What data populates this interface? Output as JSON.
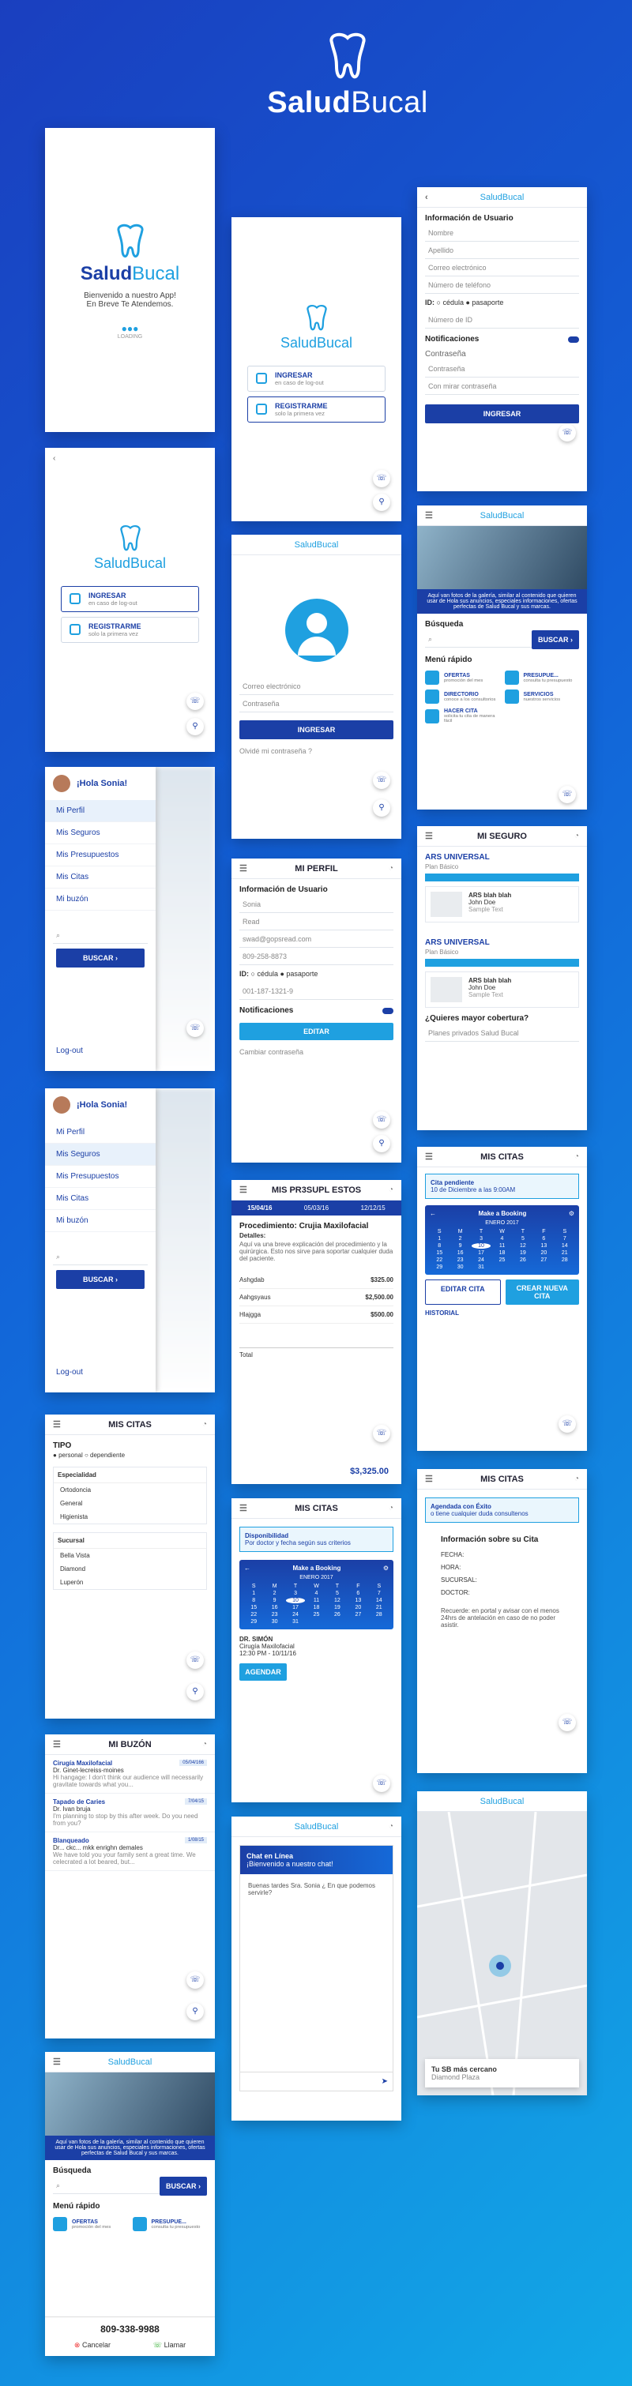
{
  "brand": {
    "name_bold": "Salud",
    "name_light": "Bucal"
  },
  "splash": {
    "welcome": "Bienvenido a nuestro App!",
    "subtitle": "En Breve Te Atendemos.",
    "loading": "LOADING"
  },
  "entry": {
    "login_title": "INGRESAR",
    "login_sub": "en caso de log-out",
    "register_title": "REGISTRARME",
    "register_sub": "solo la primera vez"
  },
  "login": {
    "email_ph": "Correo electrónico",
    "password_ph": "Contraseña",
    "submit": "INGRESAR",
    "forgot": "Olvidé mi contraseña ?"
  },
  "register": {
    "section": "Información de Usuario",
    "fields": [
      "Nombre",
      "Apellido",
      "Correo electrónico",
      "Número de teléfono"
    ],
    "id_label": "ID:",
    "id_opt1": "cédula",
    "id_opt2": "pasaporte",
    "id_number": "Número de ID",
    "notifications": "Notificaciones",
    "password_section": "Contraseña",
    "password": "Contraseña",
    "confirm": "Con mirar contraseña",
    "submit": "INGRESAR"
  },
  "home": {
    "banner": "Aquí van fotos de la galería, similar al contenido que quieren usar de Hola sus anuncios, especiales informaciones, ofertas perfectas de Salud Bucal y sus marcas.",
    "search_label": "Búsqueda",
    "search_button": "BUSCAR ›",
    "quick_label": "Menú rápido",
    "quick": [
      {
        "title": "OFERTAS",
        "sub": "promoción del mes"
      },
      {
        "title": "PRESUPUE...",
        "sub": "consulta tu presupuesto"
      },
      {
        "title": "DIRECTORIO",
        "sub": "conoce a los consultorios"
      },
      {
        "title": "SERVICIOS",
        "sub": "nuestros servicios"
      },
      {
        "title": "HACER CITA",
        "sub": "solicita tu cita de manera fácil"
      }
    ],
    "phone": "809-338-9988",
    "cancel": "Cancelar",
    "call": "Llamar"
  },
  "drawer": {
    "greeting": "¡Hola Sonia!",
    "items": [
      "Mi Perfil",
      "Mis Seguros",
      "Mis Presupuestos",
      "Mis Citas",
      "Mi buzón"
    ],
    "search_button": "BUSCAR ›",
    "logout": "Log-out"
  },
  "profile": {
    "title": "MI PERFIL",
    "section": "Información de Usuario",
    "values": [
      "Sonia",
      "Read",
      "swad@gopsread.com",
      "809-258-8873"
    ],
    "id_label": "ID:",
    "id_opt1": "cédula",
    "id_opt2": "pasaporte",
    "id_value": "001-187-1321-9",
    "notifications": "Notificaciones",
    "edit": "EDITAR",
    "change_password": "Cambiar contraseña"
  },
  "insurance": {
    "title": "MI SEGURO",
    "cards": [
      {
        "name": "ARS UNIVERSAL",
        "plan": "Plan Básico",
        "holder": "ARS blah blah",
        "person": "John Doe",
        "extra": "Sample Text"
      },
      {
        "name": "ARS UNIVERSAL",
        "plan": "Plan Básico",
        "holder": "ARS blah blah",
        "person": "John Doe",
        "extra": "Sample Text"
      }
    ],
    "question": "¿Quieres mayor cobertura?",
    "offer": "Planes privados Salud Bucal"
  },
  "budgets": {
    "title": "MIS PR3SUPL ESTOS",
    "dates": [
      "15/04/16",
      "05/03/16",
      "12/12/15"
    ],
    "procedure": "Procedimiento: Crujia Maxilofacial",
    "details_label": "Detalles:",
    "details": "Aquí va una breve explicación del procedimiento y la quirúrgica. Esto nos sirve para soportar cualquier duda del paciente.",
    "rows": [
      {
        "name": "Ashgdab",
        "value": "$325.00"
      },
      {
        "name": "Aahgsyaus",
        "value": "$2,500.00"
      },
      {
        "name": "Hlajgga",
        "value": "$500.00"
      }
    ],
    "total_label": "Total",
    "total": "$3,325.00"
  },
  "appts": {
    "title": "MIS CITAS",
    "pending": "Cita pendiente",
    "pending_sub": "10 de Diciembre a las 9:00AM",
    "cal_title": "Make a Booking",
    "month": "ENERO 2017",
    "days": [
      "S",
      "M",
      "T",
      "W",
      "T",
      "F",
      "S"
    ],
    "dates": [
      "1",
      "2",
      "3",
      "4",
      "5",
      "6",
      "7",
      "8",
      "9",
      "10",
      "11",
      "12",
      "13",
      "14",
      "15",
      "16",
      "17",
      "18",
      "19",
      "20",
      "21",
      "22",
      "23",
      "24",
      "25",
      "26",
      "27",
      "28",
      "29",
      "30",
      "31"
    ],
    "edit": "EDITAR CITA",
    "new": "CREAR NUEVA CITA",
    "history": "HISTORIAL"
  },
  "filter": {
    "title": "MIS CITAS",
    "type": "TIPO",
    "opt1": "personal",
    "opt2": "dependiente",
    "specialty": "Especialidad",
    "specialties": [
      "Ortodoncia",
      "General",
      "Higienista"
    ],
    "branch": "Sucursal",
    "branches": [
      "Bella Vista",
      "Diamond",
      "Luperón"
    ]
  },
  "avail": {
    "title": "MIS CITAS",
    "note": "Disponibilidad",
    "note_sub": "Por doctor y fecha según sus criterios",
    "doctor": "DR. SIMÓN",
    "specialty": "Cirugía Maxilofacial",
    "time": "12:30 PM - 10/11/16",
    "book": "AGENDAR"
  },
  "success": {
    "title": "MIS CITAS",
    "note": "Agendada con Éxito",
    "note_sub": "o tiene cualquier duda consultenos",
    "info": "Información sobre su Cita",
    "fields": [
      "FECHA:",
      "HORA:",
      "SUCURSAL:",
      "DOCTOR:"
    ],
    "reminder": "Recuerde: en portal y avisar con el menos 24hrs de antelación en caso de no poder asistir."
  },
  "inbox": {
    "title": "MI BUZÓN",
    "mails": [
      {
        "subject": "Cirugía Maxilofacial",
        "from": "Dr. Ginet-lecreiss-moines",
        "body": "Hi hangage: I don't think our audience will necessarily gravitate towards what you...",
        "date": "05/04/166"
      },
      {
        "subject": "Tapado de Caries",
        "from": "Dr. Ivan bruja",
        "body": "I'm planning to stop by this after week. Do you need from you?",
        "date": "7/04/15"
      },
      {
        "subject": "Blanqueado",
        "from": "Dr... ckc... mkk enrighn demales",
        "body": "We have told you your family sent a great time. We celecrated a lot beared, but...",
        "date": "1/08/15"
      }
    ]
  },
  "chat": {
    "header": "Chat en Línea",
    "sub": "¡Bienvenido a nuestro chat!",
    "message": "Buenas tardes Sra. Sonia ¿ En que podemos servirle?"
  },
  "map": {
    "nearest": "Tu SB más cercano",
    "place": "Diamond Plaza"
  }
}
